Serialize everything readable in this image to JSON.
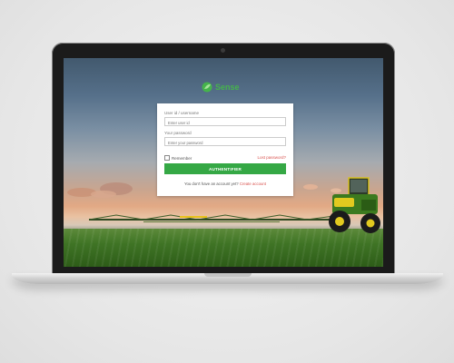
{
  "app": {
    "brand": "Sense"
  },
  "login": {
    "username_label": "User id / username",
    "username_placeholder": "Enter user id",
    "password_label": "Your password",
    "password_placeholder": "Enter your password",
    "remember_label": "Remember",
    "forgot_label": "Lost password?",
    "submit_label": "AUTHENTIFIER",
    "signup_prompt": "You don't have an account yet?",
    "signup_link": "Create account"
  },
  "colors": {
    "accent": "#35a845",
    "link": "#d9534f"
  },
  "icons": [
    "leaf-logo-icon",
    "checkbox-icon",
    "camera-icon"
  ]
}
